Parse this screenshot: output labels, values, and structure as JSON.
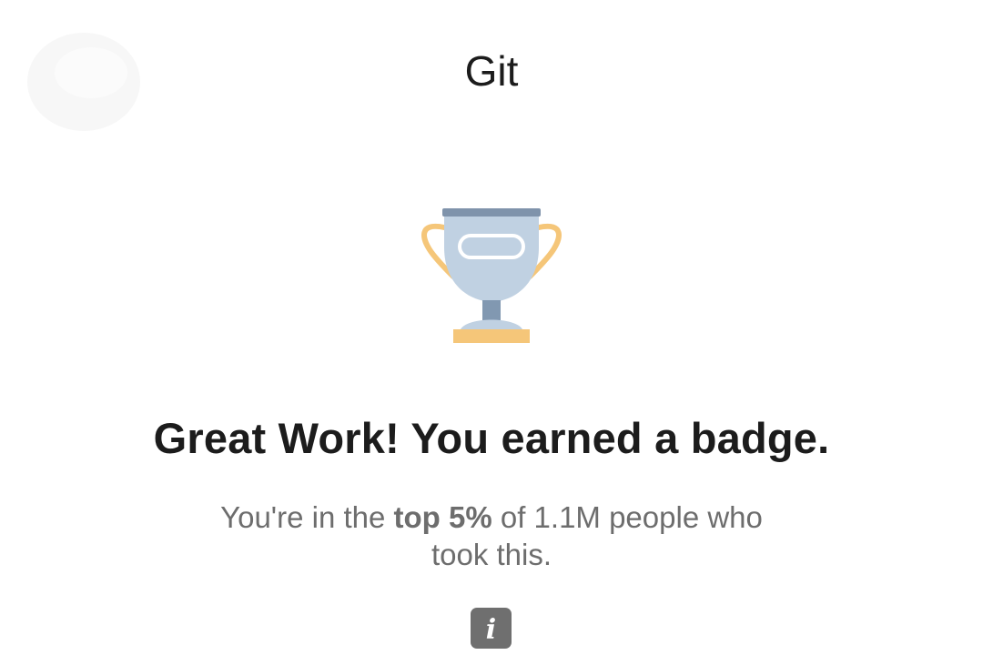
{
  "header": {
    "title": "Git",
    "close_icon": "close-icon"
  },
  "badge": {
    "icon": "trophy-icon",
    "colors": {
      "cup": "#c0d1e2",
      "rim": "#7f93ab",
      "handles": "#f5c679",
      "base": "#f5c679",
      "stem": "#8198b1"
    }
  },
  "message": {
    "headline": "Great Work! You earned a badge.",
    "line_prefix": "You're in the ",
    "line_emphasis": "top 5%",
    "line_suffix": " of 1.1M people who took this."
  },
  "info": {
    "icon": "info-icon",
    "glyph": "i"
  }
}
